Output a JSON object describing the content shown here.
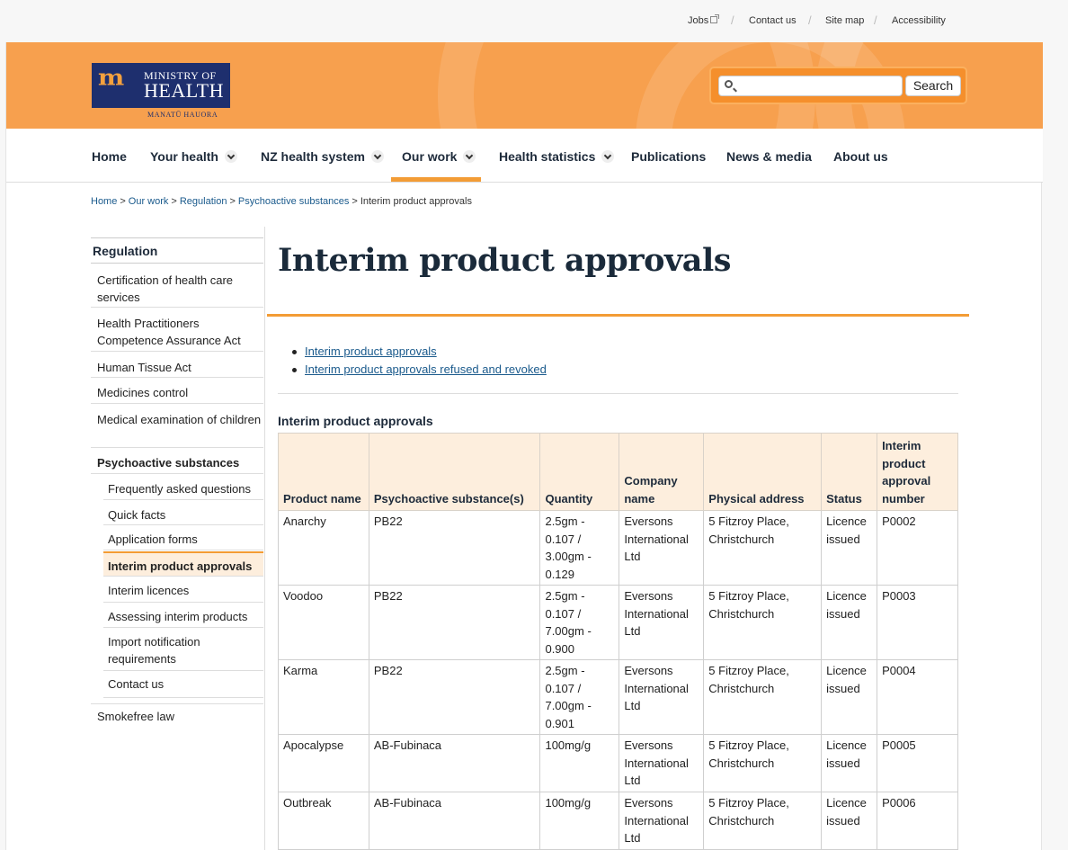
{
  "utility_nav": {
    "jobs": "Jobs",
    "contact": "Contact us",
    "sitemap": "Site map",
    "accessibility": "Accessibility"
  },
  "logo": {
    "line1": "MINISTRY OF",
    "line2": "HEALTH",
    "sub": "MANATŪ HAUORA"
  },
  "search": {
    "placeholder": "",
    "button": "Search"
  },
  "main_nav": [
    {
      "label": "Home"
    },
    {
      "label": "Your health"
    },
    {
      "label": "NZ health system"
    },
    {
      "label": "Our work"
    },
    {
      "label": "Health statistics"
    },
    {
      "label": "Publications"
    },
    {
      "label": "News & media"
    },
    {
      "label": "About us"
    }
  ],
  "breadcrumb": [
    "Home",
    "Our work",
    "Regulation",
    "Psychoactive substances",
    "Interim product approvals"
  ],
  "sidebar": {
    "title": "Regulation",
    "items": [
      "Certification of health care services",
      "Health Practitioners Competence Assurance Act",
      "Human Tissue Act",
      "Medicines control",
      "Medical examination of children",
      "Psychoactive substances",
      "Frequently asked questions",
      "Quick facts",
      "Application forms",
      "Interim product approvals",
      "Interim licences",
      "Assessing interim products",
      "Import notification requirements",
      "Contact us",
      "Smokefree law"
    ]
  },
  "page_title": "Interim product approvals",
  "toc": [
    "Interim product approvals",
    "Interim product approvals refused and revoked"
  ],
  "table": {
    "caption": "Interim product approvals",
    "headers": [
      "Product name",
      "Psychoactive substance(s)",
      "Quantity",
      "Company name",
      "Physical address",
      "Status",
      "Interim product approval number"
    ],
    "rows": [
      [
        "Anarchy",
        "PB22",
        "2.5gm - 0.107 / 3.00gm - 0.129",
        "Eversons International Ltd",
        "5 Fitzroy Place, Christchurch",
        "Licence issued",
        "P0002"
      ],
      [
        "Voodoo",
        "PB22",
        "2.5gm - 0.107 / 7.00gm - 0.900",
        "Eversons International Ltd",
        "5 Fitzroy Place, Christchurch",
        "Licence issued",
        "P0003"
      ],
      [
        "Karma",
        "PB22",
        "2.5gm - 0.107 / 7.00gm - 0.901",
        "Eversons International Ltd",
        "5 Fitzroy Place, Christchurch",
        "Licence issued",
        "P0004"
      ],
      [
        "Apocalypse",
        "AB-Fubinaca",
        "100mg/g",
        "Eversons International Ltd",
        "5 Fitzroy Place, Christchurch",
        "Licence issued",
        "P0005"
      ],
      [
        "Outbreak",
        "AB-Fubinaca",
        "100mg/g",
        "Eversons International Ltd",
        "5 Fitzroy Place, Christchurch",
        "Licence issued",
        "P0006"
      ]
    ]
  },
  "colors": {
    "header_orange": "#f7a04e",
    "accent_orange": "#f39c35",
    "logo_navy": "#1e2f6e",
    "link_blue": "#1a5a8c",
    "table_header_bg": "#fdeedd"
  }
}
